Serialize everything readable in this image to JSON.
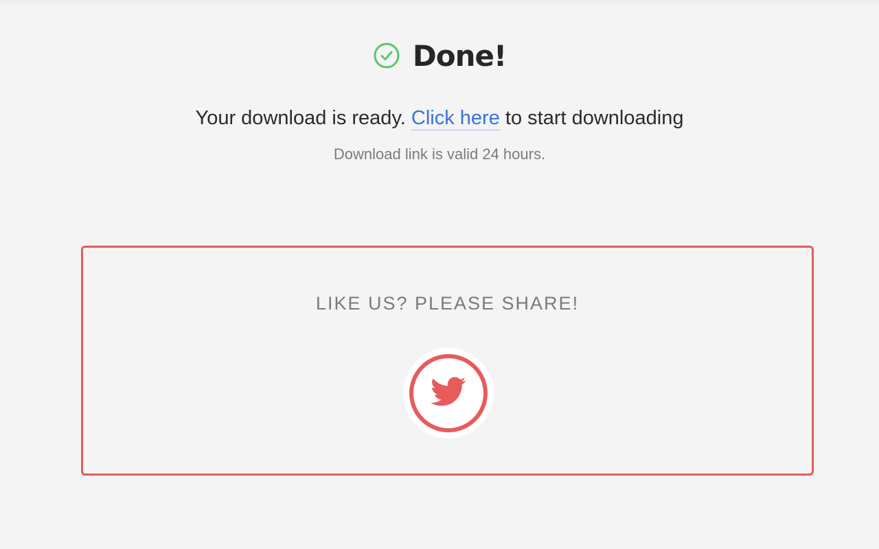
{
  "header": {
    "title": "Done!",
    "icon": "check-circle-icon",
    "accent_color": "#5cc46a"
  },
  "message": {
    "before_link": "Your download is ready. ",
    "link_text": "Click here",
    "after_link": " to start downloading",
    "link_color": "#3b72d9"
  },
  "validity": {
    "text": "Download link is valid 24 hours."
  },
  "share": {
    "title": "LIKE US? PLEASE SHARE!",
    "button_icon": "twitter-icon",
    "border_color": "#e85b5b"
  }
}
